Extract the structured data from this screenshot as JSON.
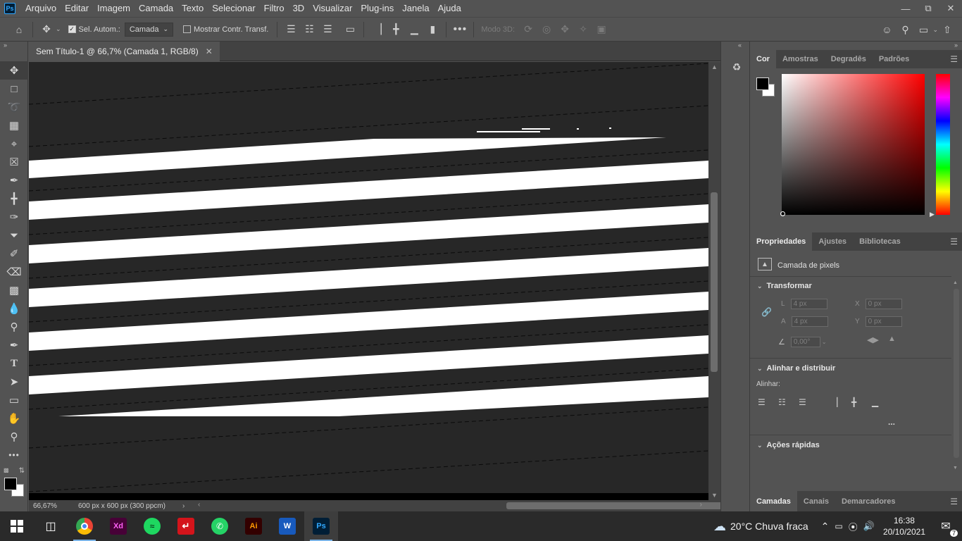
{
  "app": {
    "logo_text": "Ps",
    "menu": [
      "Arquivo",
      "Editar",
      "Imagem",
      "Camada",
      "Texto",
      "Selecionar",
      "Filtro",
      "3D",
      "Visualizar",
      "Plug-ins",
      "Janela",
      "Ajuda"
    ]
  },
  "window_controls": [
    "minimize-icon",
    "restore-icon",
    "close-icon"
  ],
  "options_bar": {
    "auto_select_label": "Sel. Autom.:",
    "auto_select_checked": true,
    "auto_select_target": "Camada",
    "show_transform_label": "Mostrar Contr. Transf.",
    "show_transform_checked": false,
    "mode_3d_label": "Modo 3D:"
  },
  "document": {
    "tab_title": "Sem Título-1 @ 66,7% (Camada 1, RGB/8)",
    "zoom": "66,67%",
    "doc_info": "600 px x 600 px (300 ppcm)"
  },
  "tools": [
    "move-tool",
    "marquee-tool",
    "lasso-tool",
    "object-select-tool",
    "crop-tool",
    "frame-tool",
    "eyedropper-tool",
    "healing-tool",
    "brush-tool",
    "stamp-tool",
    "history-brush-tool",
    "eraser-tool",
    "gradient-tool",
    "blur-tool",
    "dodge-tool",
    "pen-tool",
    "type-tool",
    "path-select-tool",
    "rectangle-tool",
    "hand-tool",
    "zoom-tool",
    "more-tools"
  ],
  "color_panel": {
    "tabs": [
      "Cor",
      "Amostras",
      "Degradês",
      "Padrões"
    ],
    "active_tab": "Cor",
    "foreground": "#000000",
    "background": "#ffffff",
    "hue_color": "#ff0000"
  },
  "properties_panel": {
    "tabs": [
      "Propriedades",
      "Ajustes",
      "Bibliotecas"
    ],
    "active_tab": "Propriedades",
    "layer_type": "Camada de pixels",
    "transform": {
      "title": "Transformar",
      "w_label": "L",
      "w_value": "4 px",
      "h_label": "A",
      "h_value": "4 px",
      "x_label": "X",
      "x_value": "0 px",
      "y_label": "Y",
      "y_value": "0 px",
      "angle_value": "0,00°"
    },
    "align": {
      "title": "Alinhar e distribuir",
      "sub_label": "Alinhar:",
      "more": "..."
    },
    "quick_actions": {
      "title": "Ações rápidas"
    }
  },
  "layers_panel": {
    "tabs": [
      "Camadas",
      "Canais",
      "Demarcadores"
    ],
    "active_tab": "Camadas"
  },
  "taskbar": {
    "apps": [
      {
        "name": "chrome",
        "label": ""
      },
      {
        "name": "adobe-xd",
        "label": "Xd"
      },
      {
        "name": "spotify",
        "label": ""
      },
      {
        "name": "acrobat",
        "label": ""
      },
      {
        "name": "whatsapp",
        "label": ""
      },
      {
        "name": "illustrator",
        "label": "Ai"
      },
      {
        "name": "word",
        "label": "W"
      },
      {
        "name": "photoshop",
        "label": "Ps"
      }
    ],
    "weather": "20°C  Chuva fraca",
    "time": "16:38",
    "date": "20/10/2021",
    "notifications": "7"
  }
}
